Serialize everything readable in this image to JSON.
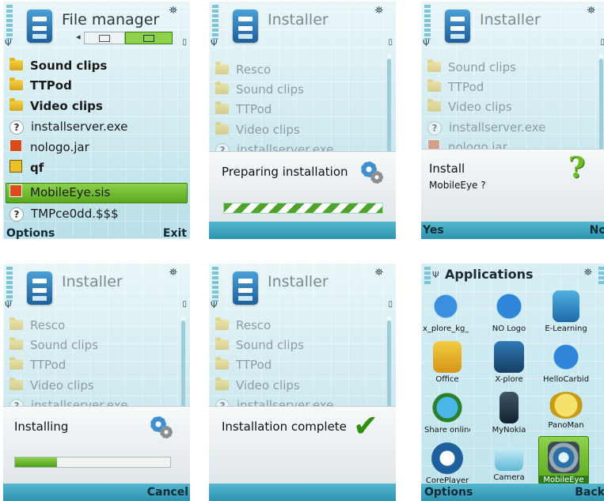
{
  "colors": {
    "accent_green": "#6cbc2a",
    "softbar_blue": "#3aa2c0"
  },
  "screen1": {
    "title": "File manager",
    "items": [
      {
        "label": "Sound clips",
        "icon": "folder-icon"
      },
      {
        "label": "TTPod",
        "icon": "folder-icon"
      },
      {
        "label": "Video clips",
        "icon": "folder-icon"
      },
      {
        "label": "installserver.exe",
        "icon": "unknown-file-icon"
      },
      {
        "label": "nologo.jar",
        "icon": "jar-file-icon"
      },
      {
        "label": "qf",
        "icon": "note-icon"
      },
      {
        "label": "MobileEye.sis",
        "icon": "sis-file-icon"
      },
      {
        "label": "TMPce0dd.$$$",
        "icon": "unknown-file-icon"
      }
    ],
    "selected": "MobileEye.sis",
    "left_softkey": "Options",
    "right_softkey": "Exit"
  },
  "screen2": {
    "title": "Installer",
    "items": [
      "Resco",
      "Sound clips",
      "TTPod",
      "Video clips",
      "installserver.exe"
    ],
    "dialog_text": "Preparing installation"
  },
  "screen3": {
    "title": "Installer",
    "items": [
      "Sound clips",
      "TTPod",
      "Video clips",
      "installserver.exe",
      "nologo.jar"
    ],
    "dialog_title": "Install",
    "dialog_sub": "MobileEye ?",
    "left_softkey": "Yes",
    "right_softkey": "No"
  },
  "screen4": {
    "title": "Installer",
    "items": [
      "Resco",
      "Sound clips",
      "TTPod",
      "Video clips",
      "installserver.exe"
    ],
    "dialog_text": "Installing",
    "progress": 0.27,
    "right_softkey": "Cancel"
  },
  "screen5": {
    "title": "Installer",
    "items": [
      "Resco",
      "Sound clips",
      "TTPod",
      "Video clips",
      "installserver.exe"
    ],
    "dialog_text": "Installation complete"
  },
  "screen6": {
    "title": "Applications",
    "apps": [
      "x_plore_kg_...",
      "NO Logo",
      "E-Learning",
      "Office",
      "X-plore",
      "HelloCarbide",
      "Share online",
      "MyNokia",
      "PanoMan",
      "CorePlayer",
      "Camera",
      "MobileEye"
    ],
    "selected": "MobileEye",
    "left_softkey": "Options",
    "right_softkey": "Back"
  }
}
